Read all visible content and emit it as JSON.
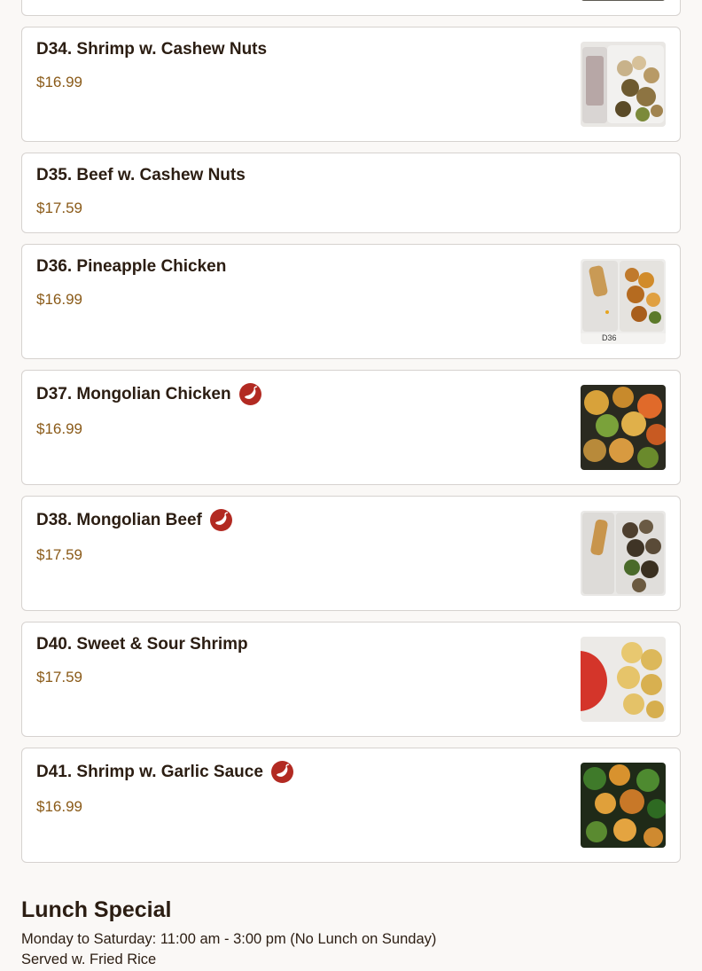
{
  "menu": {
    "items": [
      {
        "name": "D34. Shrimp w. Cashew Nuts",
        "price": "$16.99",
        "spicy": false,
        "image": "cashew-shrimp-photo"
      },
      {
        "name": "D35. Beef w. Cashew Nuts",
        "price": "$17.59",
        "spicy": false,
        "image": ""
      },
      {
        "name": "D36. Pineapple Chicken",
        "price": "$16.99",
        "spicy": false,
        "image": "pineapple-chicken-photo",
        "image_caption": "D36"
      },
      {
        "name": "D37. Mongolian Chicken",
        "price": "$16.99",
        "spicy": true,
        "image": "mongolian-chicken-photo"
      },
      {
        "name": "D38. Mongolian Beef",
        "price": "$17.59",
        "spicy": true,
        "image": "mongolian-beef-photo"
      },
      {
        "name": "D40. Sweet & Sour Shrimp",
        "price": "$17.59",
        "spicy": false,
        "image": "sweet-sour-shrimp-photo"
      },
      {
        "name": "D41. Shrimp w. Garlic Sauce",
        "price": "$16.99",
        "spicy": true,
        "image": "garlic-shrimp-photo"
      }
    ]
  },
  "lunch_special": {
    "title": "Lunch Special",
    "hours": "Monday to Saturday: 11:00 am - 3:00 pm (No Lunch on Sunday)",
    "note": "Served w. Fried Rice"
  },
  "colors": {
    "price": "#8a5a18",
    "spicy_badge": "#b22a22",
    "card_border": "#d6d2cf",
    "background": "#faf8f6"
  },
  "icons": {
    "spicy": "chili-pepper-icon"
  }
}
